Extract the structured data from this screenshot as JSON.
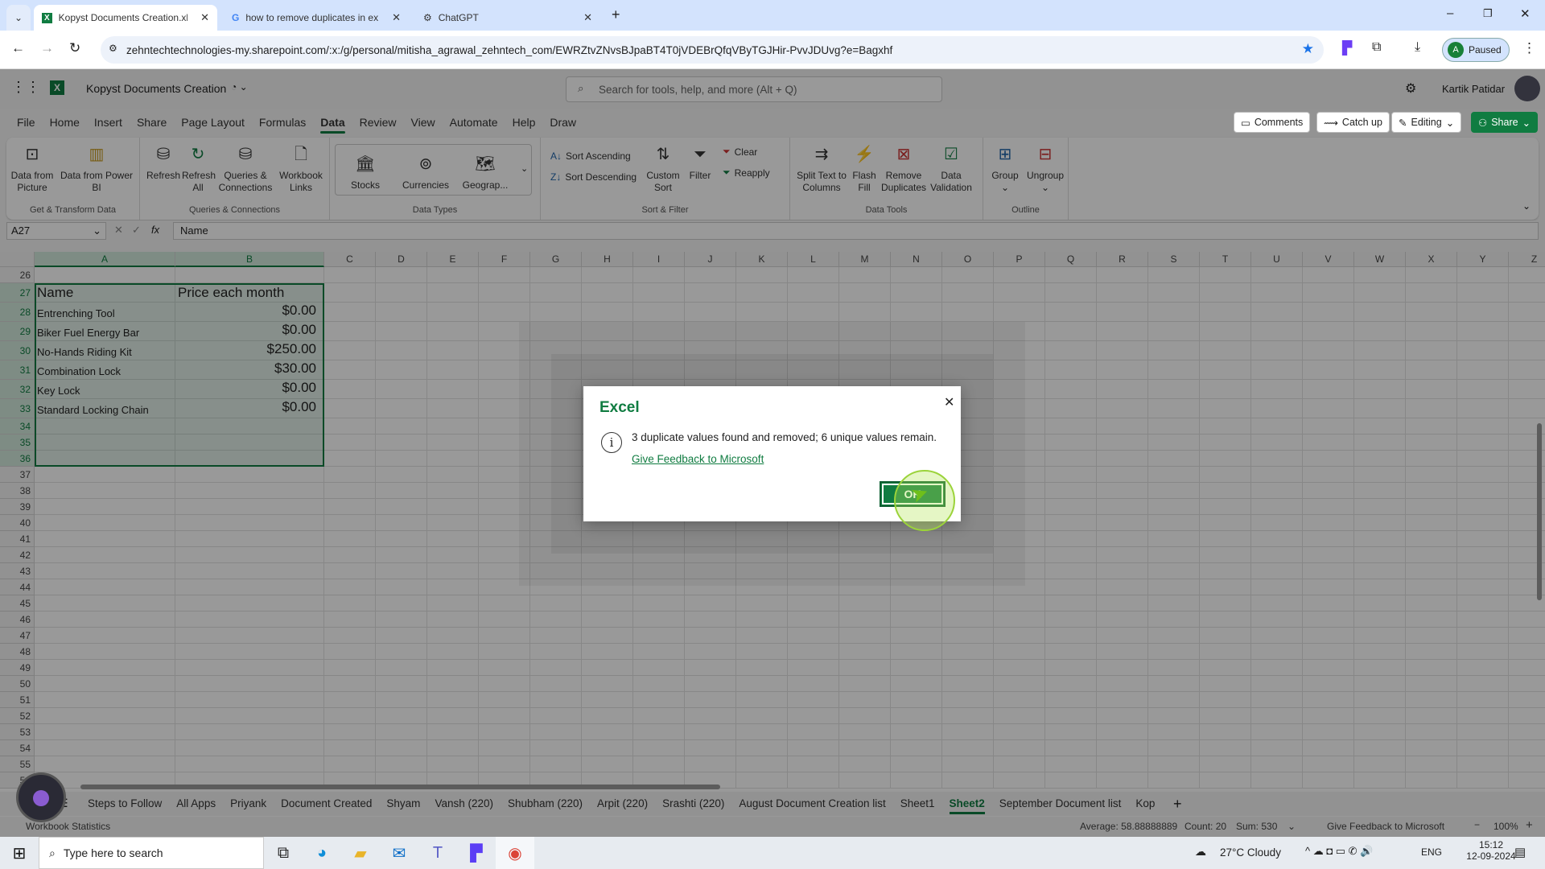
{
  "browser": {
    "tabs": [
      {
        "title": "Kopyst Documents Creation.xlsx",
        "active": true
      },
      {
        "title": "how to remove duplicates in ex",
        "active": false
      },
      {
        "title": "ChatGPT",
        "active": false
      }
    ],
    "url": "zehntechtechnologies-my.sharepoint.com/:x:/g/personal/mitisha_agrawal_zehntech_com/EWRZtvZNvsBJpaBT4T0jVDEBrQfqVByTGJHir-PvvJDUvg?e=Bagxhf",
    "profile_label": "Paused",
    "profile_initial": "A"
  },
  "excel": {
    "doc_title": "Kopyst Documents Creation",
    "search_placeholder": "Search for tools, help, and more (Alt + Q)",
    "user_name": "Kartik Patidar",
    "menu": [
      "File",
      "Home",
      "Insert",
      "Share",
      "Page Layout",
      "Formulas",
      "Data",
      "Review",
      "View",
      "Automate",
      "Help",
      "Draw"
    ],
    "active_menu": "Data",
    "right_buttons": {
      "comments": "Comments",
      "catchup": "Catch up",
      "editing": "Editing",
      "share": "Share"
    },
    "ribbon": {
      "groups": {
        "get": "Get & Transform Data",
        "queries": "Queries & Connections",
        "types": "Data Types",
        "sort": "Sort & Filter",
        "tools": "Data Tools",
        "outline": "Outline"
      },
      "data_from_picture": "Data from Picture",
      "data_from_powerbi": "Data from Power BI",
      "refresh": "Refresh",
      "refresh_all": "Refresh All",
      "queries_conn": "Queries & Connections",
      "workbook_links": "Workbook Links",
      "stocks": "Stocks",
      "currencies": "Currencies",
      "geography": "Geograp...",
      "sort_asc": "Sort Ascending",
      "sort_desc": "Sort Descending",
      "custom_sort": "Custom Sort",
      "filter": "Filter",
      "clear": "Clear",
      "reapply": "Reapply",
      "split": "Split Text to Columns",
      "flash": "Flash Fill",
      "remove_dup": "Remove Duplicates",
      "validation": "Data Validation",
      "group": "Group",
      "ungroup": "Ungroup"
    },
    "name_box": "A27",
    "formula": "Name",
    "columns": [
      "A",
      "B",
      "C",
      "D",
      "E",
      "F",
      "G",
      "H",
      "I",
      "J",
      "K",
      "L",
      "M",
      "N",
      "O",
      "P",
      "Q",
      "R",
      "S",
      "T",
      "U",
      "V",
      "W",
      "X",
      "Y",
      "Z"
    ],
    "rows_start": 26,
    "rows_end": 56,
    "table": {
      "header": [
        "Name",
        "Price each month"
      ],
      "rows": [
        [
          "Entrenching Tool",
          "$0.00"
        ],
        [
          "Biker Fuel Energy Bar",
          "$0.00"
        ],
        [
          "No-Hands Riding Kit",
          "$250.00"
        ],
        [
          "Combination Lock",
          "$30.00"
        ],
        [
          "Key Lock",
          "$0.00"
        ],
        [
          "Standard Locking Chain",
          "$0.00"
        ]
      ]
    },
    "sheet_tabs": [
      "Steps to Follow",
      "All Apps",
      "Priyank",
      "Document Created",
      "Shyam",
      "Vansh (220)",
      "Shubham (220)",
      "Arpit (220)",
      "Srashti (220)",
      "August Document Creation list",
      "Sheet1",
      "Sheet2",
      "September Document list",
      "Kop"
    ],
    "active_sheet": "Sheet2",
    "status": {
      "left": "Workbook Statistics",
      "average": "Average: 58.88888889",
      "count": "Count: 20",
      "sum": "Sum: 530",
      "feedback": "Give Feedback to Microsoft",
      "zoom": "100%"
    },
    "accent": "#107c41"
  },
  "dialog": {
    "title": "Excel",
    "message": "3 duplicate values found and removed; 6 unique values remain.",
    "link": "Give Feedback to Microsoft",
    "ok": "OK"
  },
  "taskbar": {
    "search_placeholder": "Type here to search",
    "weather": "27°C  Cloudy",
    "lang": "ENG",
    "time": "15:12",
    "date": "12-09-2024"
  }
}
